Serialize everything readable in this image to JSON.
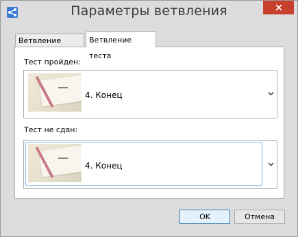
{
  "window": {
    "title": "Параметры ветвления"
  },
  "tabs": [
    {
      "label": "Ветвление слайда",
      "active": false
    },
    {
      "label": "Ветвление теста",
      "active": true
    }
  ],
  "passed": {
    "label": "Тест пройден:",
    "value": "4. Конец"
  },
  "failed": {
    "label": "Тест не сдан:",
    "value": "4. Конец"
  },
  "buttons": {
    "ok": "OK",
    "cancel": "Отмена"
  },
  "colors": {
    "close": "#c7402e",
    "focus": "#7eb4ea",
    "dialog_bg": "#dcdcdc"
  }
}
